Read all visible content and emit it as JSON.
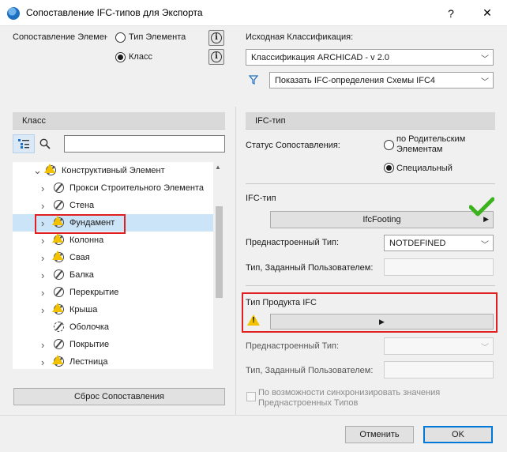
{
  "window": {
    "title": "Сопоставление IFC-типов для Экспорта",
    "help_label": "?",
    "close_label": "✕"
  },
  "top": {
    "mapping_label": "Сопоставление Элемен",
    "radio_element_type": "Тип Элемента",
    "radio_class": "Класс",
    "source_classification_label": "Исходная Классификация:",
    "source_classification_value": "Классификация ARCHICAD - v 2.0",
    "filter_value": "Показать IFC-определения Схемы IFC4"
  },
  "left": {
    "header": "Класс",
    "search_placeholder": "",
    "tree": [
      {
        "label": "Конструктивный Элемент",
        "level": 0,
        "expanded": true,
        "icon": "warning-class-icon"
      },
      {
        "label": "Прокси Строительного Элемента",
        "level": 1,
        "icon": "class-icon"
      },
      {
        "label": "Стена",
        "level": 1,
        "icon": "class-icon"
      },
      {
        "label": "Фундамент",
        "level": 1,
        "icon": "warning-class-icon",
        "selected": true
      },
      {
        "label": "Колонна",
        "level": 1,
        "icon": "warning-class-icon"
      },
      {
        "label": "Свая",
        "level": 1,
        "icon": "warning-class-icon"
      },
      {
        "label": "Балка",
        "level": 1,
        "icon": "class-icon"
      },
      {
        "label": "Перекрытие",
        "level": 1,
        "icon": "class-icon"
      },
      {
        "label": "Крыша",
        "level": 1,
        "icon": "warning-class-icon"
      },
      {
        "label": "Оболочка",
        "level": 1,
        "icon": "shell-icon",
        "no_chevron": true
      },
      {
        "label": "Покрытие",
        "level": 1,
        "icon": "class-icon"
      },
      {
        "label": "Лестница",
        "level": 1,
        "icon": "warning-class-icon"
      }
    ],
    "reset_button": "Сброс Сопоставления"
  },
  "right": {
    "header": "IFC-тип",
    "mapping_status_label": "Статус Сопоставления:",
    "radio_parent": "по Родительским\nЭлементам",
    "radio_special": "Специальный",
    "ifc_type_label": "IFC-тип",
    "ifc_type_value": "IfcFooting",
    "predefined_label": "Преднастроенный Тип:",
    "predefined_value": "NOTDEFINED",
    "user_defined_label": "Тип, Заданный Пользователем:",
    "product_type_label": "Тип Продукта IFC",
    "predefined2_label": "Преднастроенный Тип:",
    "user_defined2_label": "Тип, Заданный Пользователем:",
    "sync_label": "По возможности синхронизировать значения\nПреднастроенных Типов"
  },
  "footer": {
    "cancel": "Отменить",
    "ok": "OK"
  },
  "colors": {
    "accent": "#0078d7",
    "selection": "#cce4f7",
    "highlight_red": "#e02020",
    "warning": "#f2c200",
    "check_green": "#3cb31e"
  }
}
